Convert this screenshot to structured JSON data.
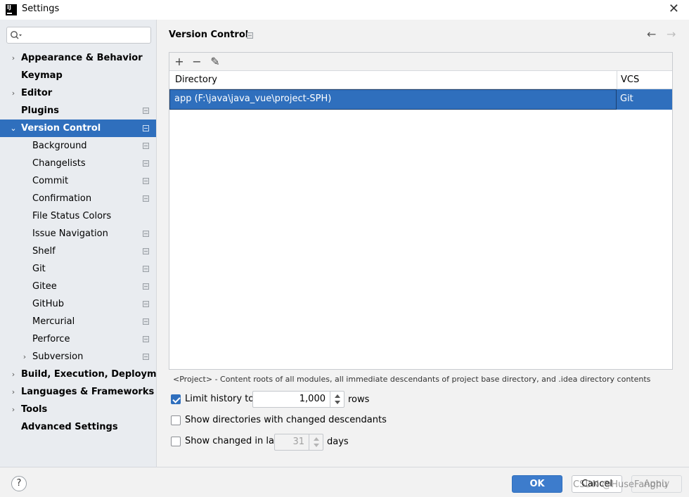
{
  "window": {
    "title": "Settings"
  },
  "search": {
    "placeholder": ""
  },
  "sidebar": {
    "items": [
      {
        "label": "Appearance & Behavior",
        "level": 0,
        "arrow": "›",
        "project": false,
        "selected": false
      },
      {
        "label": "Keymap",
        "level": 0,
        "arrow": "",
        "project": false,
        "selected": false
      },
      {
        "label": "Editor",
        "level": 0,
        "arrow": "›",
        "project": false,
        "selected": false
      },
      {
        "label": "Plugins",
        "level": 0,
        "arrow": "",
        "project": true,
        "selected": false
      },
      {
        "label": "Version Control",
        "level": 0,
        "arrow": "⌄",
        "project": true,
        "selected": true
      },
      {
        "label": "Background",
        "level": 1,
        "arrow": "",
        "project": true,
        "selected": false
      },
      {
        "label": "Changelists",
        "level": 1,
        "arrow": "",
        "project": true,
        "selected": false
      },
      {
        "label": "Commit",
        "level": 1,
        "arrow": "",
        "project": true,
        "selected": false
      },
      {
        "label": "Confirmation",
        "level": 1,
        "arrow": "",
        "project": true,
        "selected": false
      },
      {
        "label": "File Status Colors",
        "level": 1,
        "arrow": "",
        "project": false,
        "selected": false
      },
      {
        "label": "Issue Navigation",
        "level": 1,
        "arrow": "",
        "project": true,
        "selected": false
      },
      {
        "label": "Shelf",
        "level": 1,
        "arrow": "",
        "project": true,
        "selected": false
      },
      {
        "label": "Git",
        "level": 1,
        "arrow": "",
        "project": true,
        "selected": false
      },
      {
        "label": "Gitee",
        "level": 1,
        "arrow": "",
        "project": true,
        "selected": false
      },
      {
        "label": "GitHub",
        "level": 1,
        "arrow": "",
        "project": true,
        "selected": false
      },
      {
        "label": "Mercurial",
        "level": 1,
        "arrow": "",
        "project": true,
        "selected": false
      },
      {
        "label": "Perforce",
        "level": 1,
        "arrow": "",
        "project": true,
        "selected": false
      },
      {
        "label": "Subversion",
        "level": 1,
        "arrow": "›",
        "project": true,
        "selected": false
      },
      {
        "label": "Build, Execution, Deployment",
        "level": 0,
        "arrow": "›",
        "project": false,
        "selected": false
      },
      {
        "label": "Languages & Frameworks",
        "level": 0,
        "arrow": "›",
        "project": false,
        "selected": false
      },
      {
        "label": "Tools",
        "level": 0,
        "arrow": "›",
        "project": false,
        "selected": false
      },
      {
        "label": "Advanced Settings",
        "level": 0,
        "arrow": "",
        "project": false,
        "selected": false
      }
    ]
  },
  "main": {
    "title": "Version Control",
    "nav": {
      "back": "←",
      "forward": "→"
    },
    "toolbar": {
      "add": "+",
      "remove": "−",
      "edit": "✎"
    },
    "table": {
      "headers": {
        "directory": "Directory",
        "vcs": "VCS"
      },
      "rows": [
        {
          "directory": "app (F:\\java\\java_vue\\project-SPH)",
          "vcs": "Git"
        }
      ]
    },
    "hint": "<Project> - Content roots of all modules, all immediate descendants of project base directory, and .idea directory contents",
    "options": {
      "limit_history": {
        "label": "Limit history to:",
        "checked": true,
        "value": "1,000",
        "suffix": "rows"
      },
      "show_dirs": {
        "label": "Show directories with changed descendants",
        "checked": false
      },
      "show_changed": {
        "label": "Show changed in last",
        "checked": false,
        "value": "31",
        "suffix": "days"
      }
    }
  },
  "footer": {
    "help": "?",
    "ok": "OK",
    "cancel": "Cancel",
    "apply": "Apply",
    "watermark": "CSDN @HuseFanghu"
  },
  "colors": {
    "accent": "#2f6fbd",
    "sidebar_bg": "#e9ecf0",
    "panel_bg": "#f2f2f2"
  }
}
